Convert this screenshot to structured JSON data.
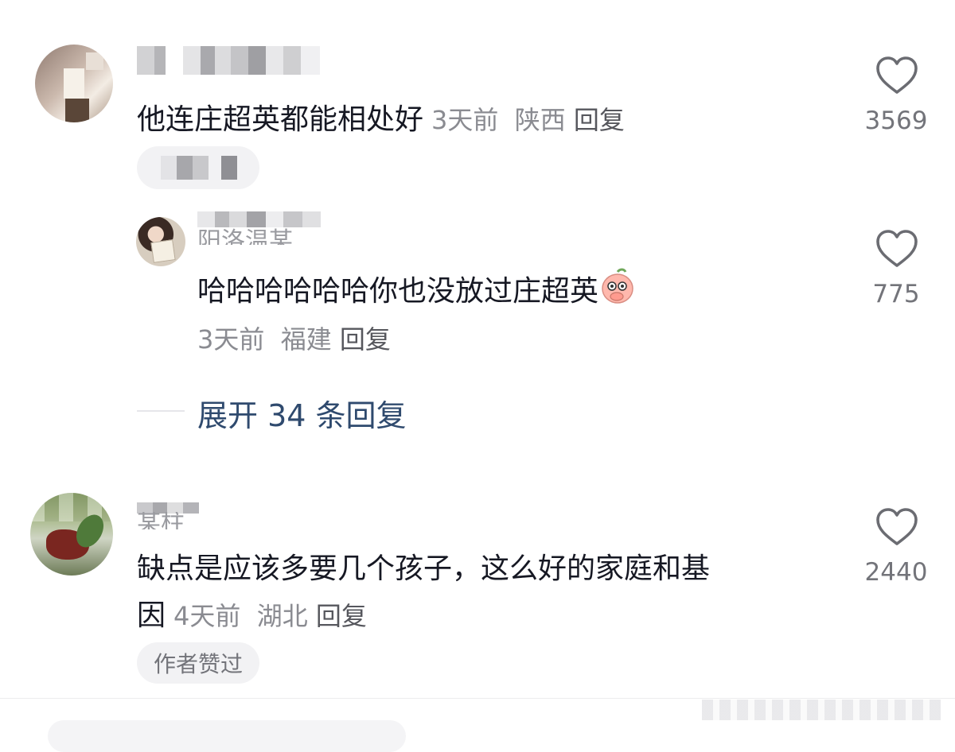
{
  "comments": [
    {
      "text": "他连庄超英都能相处好",
      "time": "3天前",
      "location": "陕西",
      "reply_label": "回复",
      "like_count": "3569"
    },
    {
      "username_partial": "阳洛温某",
      "text": "哈哈哈哈哈哈你也没放过庄超英",
      "time": "3天前",
      "location": "福建",
      "reply_label": "回复",
      "like_count": "775",
      "emoji": "peach-cover-face-emoji"
    },
    {
      "username_partial": "某柱",
      "text_line1": "缺点是应该多要几个孩子，这么好的家庭和基",
      "text_line2": "因",
      "time": "4天前",
      "location": "湖北",
      "reply_label": "回复",
      "like_count": "2440",
      "author_badge": "作者赞过"
    }
  ],
  "expand_replies": "展开 34 条回复",
  "colors": {
    "text_primary": "#161823",
    "text_meta": "#8a8b91",
    "link_blue": "#2f4a6e",
    "pill_bg": "#f2f2f4"
  },
  "icons": {
    "like": "heart-outline-icon"
  }
}
